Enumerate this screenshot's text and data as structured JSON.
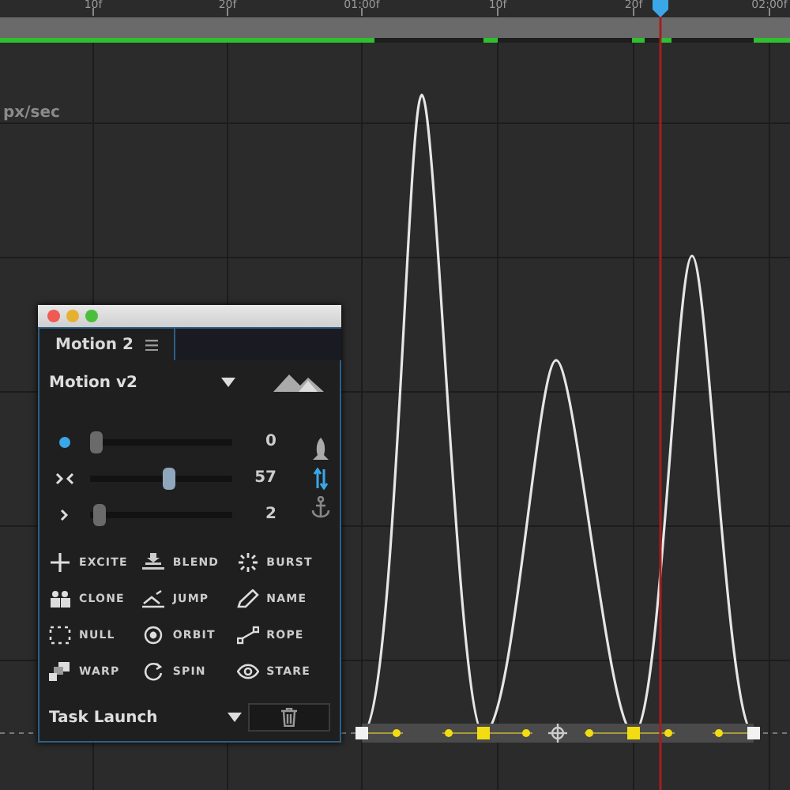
{
  "ruler": {
    "labels": [
      "10f",
      "20f",
      "01:00f",
      "10f",
      "20f",
      "02:00f"
    ]
  },
  "graph": {
    "unit": "px/sec"
  },
  "panel": {
    "tabs": [
      {
        "label": "Motion 2",
        "selected": true
      }
    ],
    "preset": "Motion v2",
    "sliders": [
      {
        "kind": "dot",
        "value": "0",
        "level": 0
      },
      {
        "kind": "pinch",
        "value": "57",
        "level": 0.57
      },
      {
        "kind": "chevron",
        "value": "2",
        "level": 0.02
      }
    ],
    "actions": [
      {
        "kind": "excite",
        "label": "EXCITE"
      },
      {
        "kind": "blend",
        "label": "BLEND"
      },
      {
        "kind": "burst",
        "label": "BURST"
      },
      {
        "kind": "clone",
        "label": "CLONE"
      },
      {
        "kind": "jump",
        "label": "JUMP"
      },
      {
        "kind": "name",
        "label": "NAME"
      },
      {
        "kind": "null",
        "label": "NULL"
      },
      {
        "kind": "orbit",
        "label": "ORBIT"
      },
      {
        "kind": "rope",
        "label": "ROPE"
      },
      {
        "kind": "warp",
        "label": "WARP"
      },
      {
        "kind": "spin",
        "label": "SPIN"
      },
      {
        "kind": "stare",
        "label": "STARE"
      }
    ],
    "task": "Task Launch"
  }
}
